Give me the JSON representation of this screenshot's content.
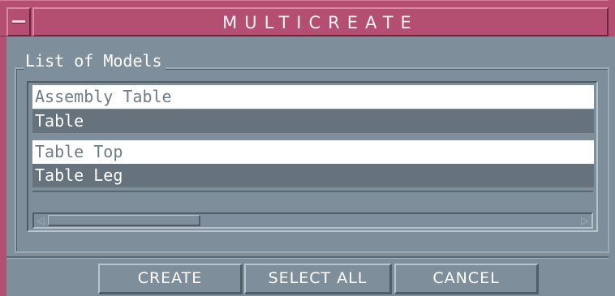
{
  "window": {
    "title": "MULTICREATE"
  },
  "models_group": {
    "label": "List of Models",
    "items": [
      {
        "label": "Assembly Table",
        "selected": false
      },
      {
        "label": "Table",
        "selected": true
      },
      {
        "label": "Table Top",
        "selected": false
      },
      {
        "label": "Table Leg",
        "selected": true
      }
    ]
  },
  "buttons": {
    "create": "CREATE",
    "select_all": "SELECT ALL",
    "cancel": "CANCEL"
  },
  "colors": {
    "title_bar": "#b44f72",
    "panel": "#7e8f9b",
    "selected_row": "#66737d",
    "unselected_row": "#ffffff"
  }
}
